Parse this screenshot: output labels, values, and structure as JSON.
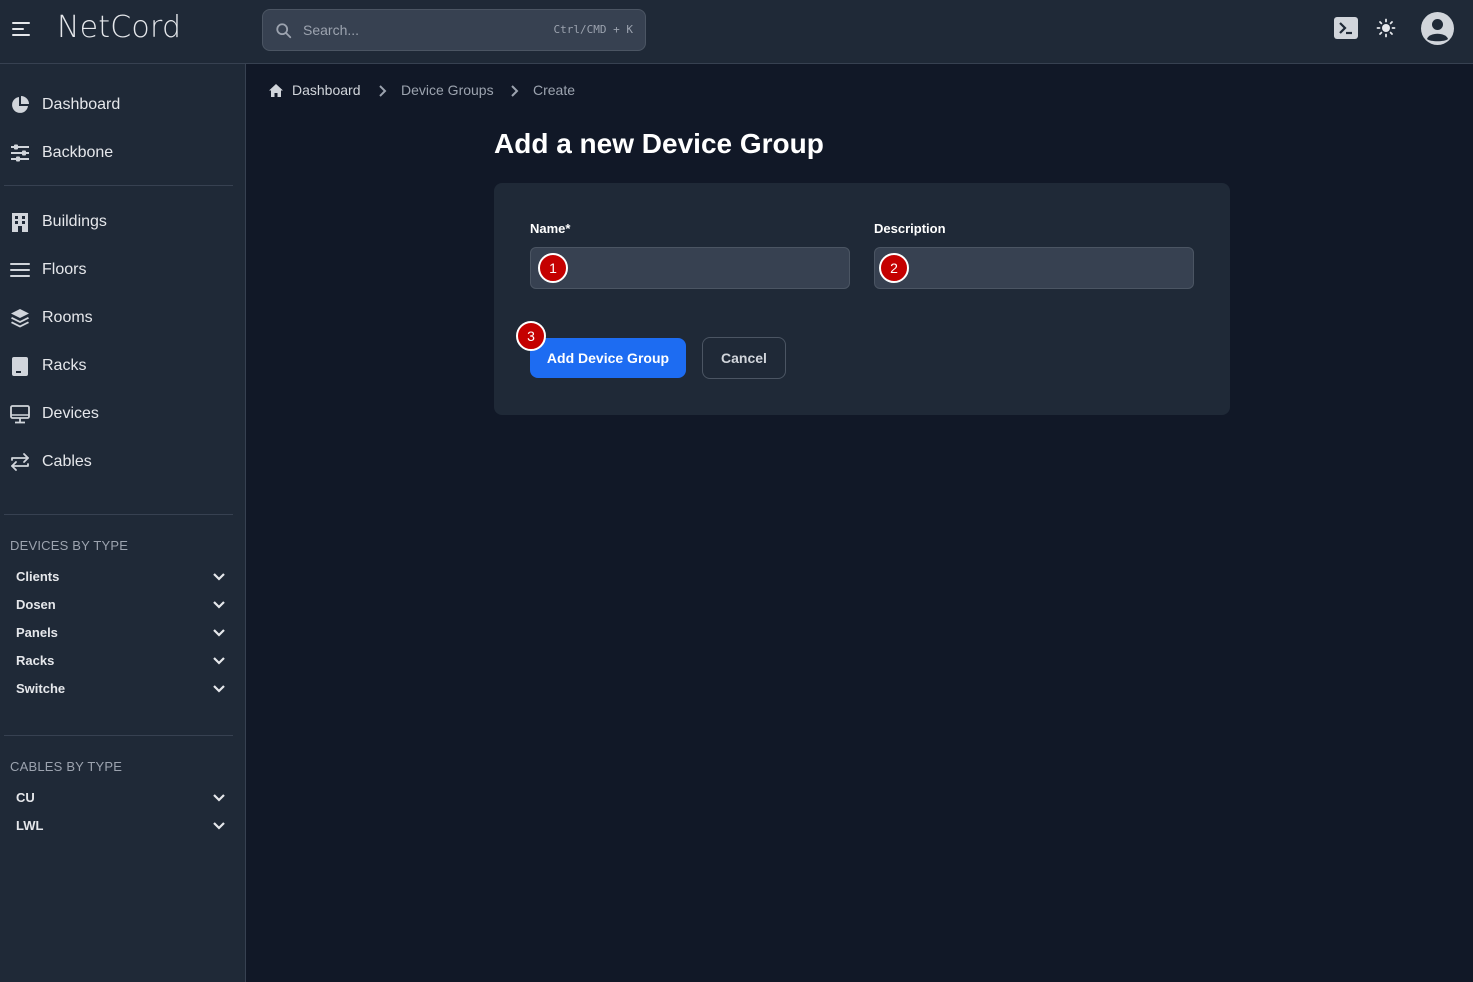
{
  "header": {
    "brand": "NetCord",
    "search_placeholder": "Search...",
    "search_shortcut": "Ctrl/CMD + K"
  },
  "sidebar": {
    "main_items": [
      {
        "label": "Dashboard",
        "icon": "chart-pie-icon"
      },
      {
        "label": "Backbone",
        "icon": "sliders-icon"
      }
    ],
    "location_items": [
      {
        "label": "Buildings",
        "icon": "building-icon"
      },
      {
        "label": "Floors",
        "icon": "bars-icon"
      },
      {
        "label": "Rooms",
        "icon": "layers-icon"
      },
      {
        "label": "Racks",
        "icon": "rack-icon"
      },
      {
        "label": "Devices",
        "icon": "monitor-icon"
      },
      {
        "label": "Cables",
        "icon": "arrows-exchange-icon"
      }
    ],
    "devices_by_type": {
      "title": "DEVICES BY TYPE",
      "items": [
        "Clients",
        "Dosen",
        "Panels",
        "Racks",
        "Switche"
      ]
    },
    "cables_by_type": {
      "title": "CABLES BY TYPE",
      "items": [
        "CU",
        "LWL"
      ]
    }
  },
  "breadcrumb": [
    "Dashboard",
    "Device Groups",
    "Create"
  ],
  "page": {
    "title": "Add a new Device Group"
  },
  "form": {
    "name_label": "Name*",
    "name_value": "",
    "description_label": "Description",
    "description_value": "",
    "submit_label": "Add Device Group",
    "cancel_label": "Cancel"
  },
  "annotations": [
    "1",
    "2",
    "3"
  ],
  "colors": {
    "background": "#111827",
    "panel": "#1f2937",
    "input": "#374151",
    "primary": "#1d6cf2",
    "badge": "#c40000"
  }
}
